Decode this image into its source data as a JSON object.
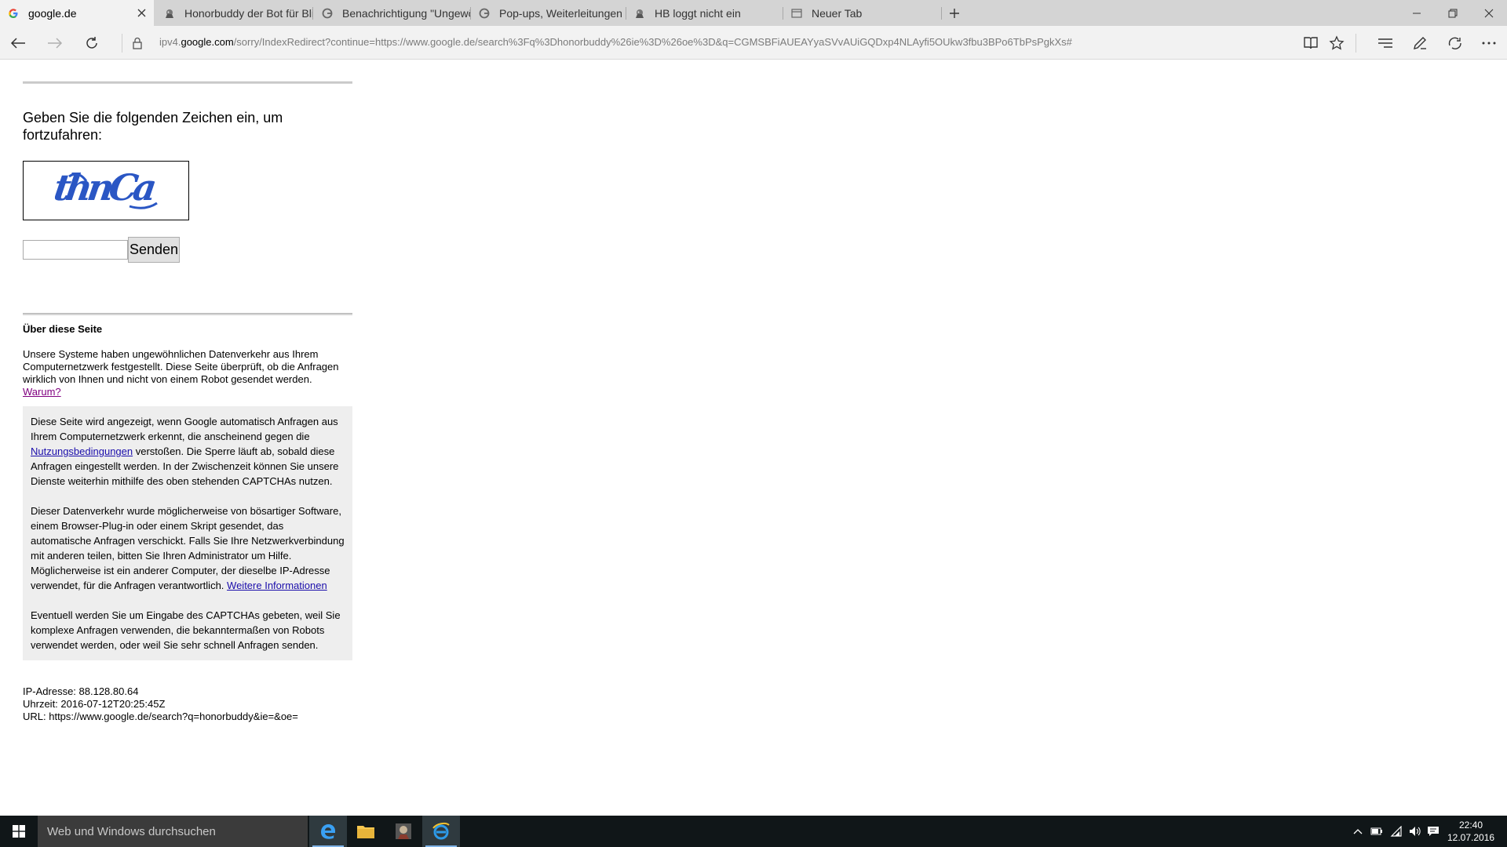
{
  "browser": {
    "tabs": [
      {
        "title": "google.de",
        "favicon": "google-g-icon",
        "active": true
      },
      {
        "title": "Honorbuddy der Bot für Bli:",
        "favicon": "honorbuddy-icon",
        "active": false
      },
      {
        "title": "Benachrichtigung \"Ungewö",
        "favicon": "google-g-icon",
        "active": false
      },
      {
        "title": "Pop-ups, Weiterleitungen u",
        "favicon": "google-g-icon",
        "active": false
      },
      {
        "title": "HB loggt nicht ein",
        "favicon": "honorbuddy-icon",
        "active": false
      },
      {
        "title": "Neuer Tab",
        "favicon": "page-icon",
        "active": false
      }
    ],
    "address": {
      "prefix": "ipv4.",
      "host": "google.com",
      "rest": "/sorry/IndexRedirect?continue=https://www.google.de/search%3Fq%3Dhonorbuddy%26ie%3D%26oe%3D&q=CGMSBFiAUEAYyaSVvAUiGQDxp4NLAyfi5OUkw3fbu3BPo6TbPsPgkXs#"
    }
  },
  "page": {
    "prompt": "Geben Sie die folgenden Zeichen ein, um fortzufahren:",
    "captcha_text": "thnCa",
    "submit_label": "Senden",
    "input_value": "",
    "about": {
      "title": "Über diese Seite",
      "text": "Unsere Systeme haben ungewöhnlichen Datenverkehr aus Ihrem Computernetzwerk festgestellt. Diese Seite überprüft, ob die Anfragen wirklich von Ihnen und nicht von einem Robot gesendet werden.",
      "why_link": "Warum?"
    },
    "info": {
      "p1_before": "Diese Seite wird angezeigt, wenn Google automatisch Anfragen aus Ihrem Computernetzwerk erkennt, die anscheinend gegen die",
      "p1_link": "Nutzungsbedingungen",
      "p1_after": "verstoßen. Die Sperre läuft ab, sobald diese Anfragen eingestellt werden. In der Zwischenzeit können Sie unsere Dienste weiterhin mithilfe des oben stehenden CAPTCHAs nutzen.",
      "p2_text": "Dieser Datenverkehr wurde möglicherweise von bösartiger Software, einem Browser-Plug-in oder einem Skript gesendet, das automatische Anfragen verschickt. Falls Sie Ihre Netzwerkverbindung mit anderen teilen, bitten Sie Ihren Administrator um Hilfe. Möglicherweise ist ein anderer Computer, der dieselbe IP-Adresse verwendet, für die Anfragen verantwortlich.",
      "p2_link": "Weitere Informationen",
      "p3_text": "Eventuell werden Sie um Eingabe des CAPTCHAs gebeten, weil Sie komplexe Anfragen verwenden, die bekanntermaßen von Robots verwendet werden, oder weil Sie sehr schnell Anfragen senden."
    },
    "meta": {
      "ip": "IP-Adresse: 88.128.80.64",
      "time": "Uhrzeit: 2016-07-12T20:25:45Z",
      "url": "URL: https://www.google.de/search?q=honorbuddy&ie=&oe="
    }
  },
  "taskbar": {
    "search_placeholder": "Web und Windows durchsuchen",
    "time": "22:40",
    "date": "12.07.2016"
  }
}
